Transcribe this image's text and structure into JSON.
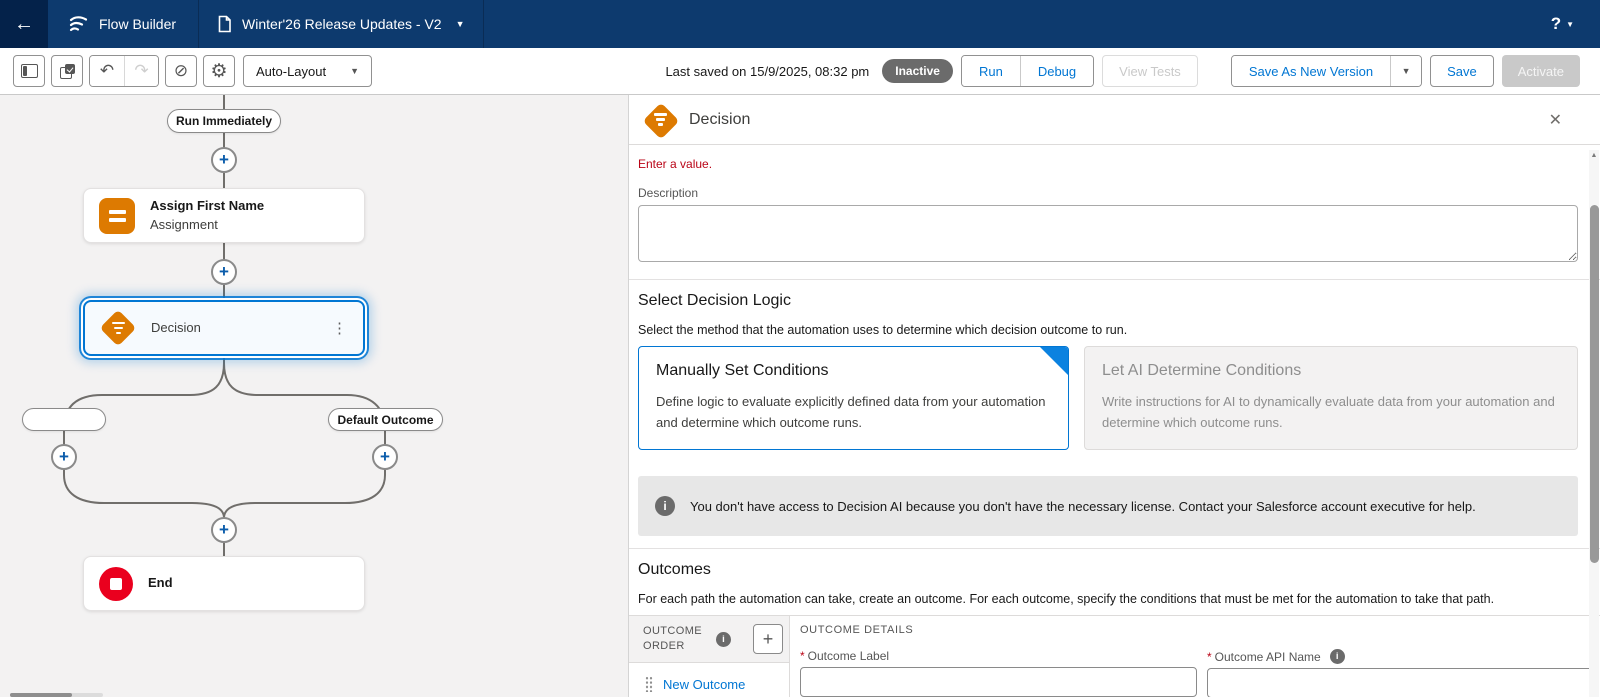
{
  "nav": {
    "app_name": "Flow Builder",
    "doc_title": "Winter'26 Release Updates - V2",
    "help": "?"
  },
  "toolbar": {
    "layout_mode": "Auto-Layout",
    "last_saved": "Last saved on 15/9/2025, 08:32 pm",
    "status_badge": "Inactive",
    "run": "Run",
    "debug": "Debug",
    "view_tests": "View Tests",
    "save_as_new_version": "Save As New Version",
    "save": "Save",
    "activate": "Activate"
  },
  "canvas": {
    "start_label": "Run Immediately",
    "assignment": {
      "title": "Assign First Name",
      "subtitle": "Assignment"
    },
    "decision": {
      "title": "Decision"
    },
    "branch_left_label": "",
    "branch_right_label": "Default Outcome",
    "end_label": "End"
  },
  "panel": {
    "title": "Decision",
    "error": "Enter a value.",
    "description_label": "Description",
    "description_value": "",
    "logic": {
      "heading": "Select Decision Logic",
      "subtext": "Select the method that the automation uses to determine which decision outcome to run.",
      "manual": {
        "title": "Manually Set Conditions",
        "body": "Define logic to evaluate explicitly defined data from your automation and determine which outcome runs."
      },
      "ai": {
        "title": "Let AI Determine Conditions",
        "body": "Write instructions for AI to dynamically evaluate data from your automation and determine which outcome runs."
      },
      "notice": "You don't have access to Decision AI because you don't have the necessary license. Contact your Salesforce account executive for help."
    },
    "outcomes": {
      "heading": "Outcomes",
      "subtext": "For each path the automation can take, create an outcome. For each outcome, specify the conditions that must be met for the automation to take that path.",
      "order_header": "OUTCOME ORDER",
      "details_header": "OUTCOME DETAILS",
      "new_outcome": "New Outcome",
      "required_marker": "*",
      "label_field": {
        "label": "Outcome Label",
        "value": ""
      },
      "api_field": {
        "label": "Outcome API Name",
        "value": ""
      }
    }
  },
  "icons": {
    "back": "←",
    "caret_down": "▼",
    "help_caret": "▼",
    "undo": "↶",
    "redo": "↷",
    "no_entry": "⊘",
    "gear": "⚙",
    "plus": "+",
    "kebab": "⋮",
    "close": "✕",
    "info": "i",
    "scroll_up": "▲"
  },
  "colors": {
    "brand_navy": "#0d3a6e",
    "accent_blue": "#0176d3",
    "flow_orange": "#dd7a01",
    "end_red": "#ea001e",
    "error_red": "#ba0517",
    "badge_gray": "#6b6b6b"
  }
}
